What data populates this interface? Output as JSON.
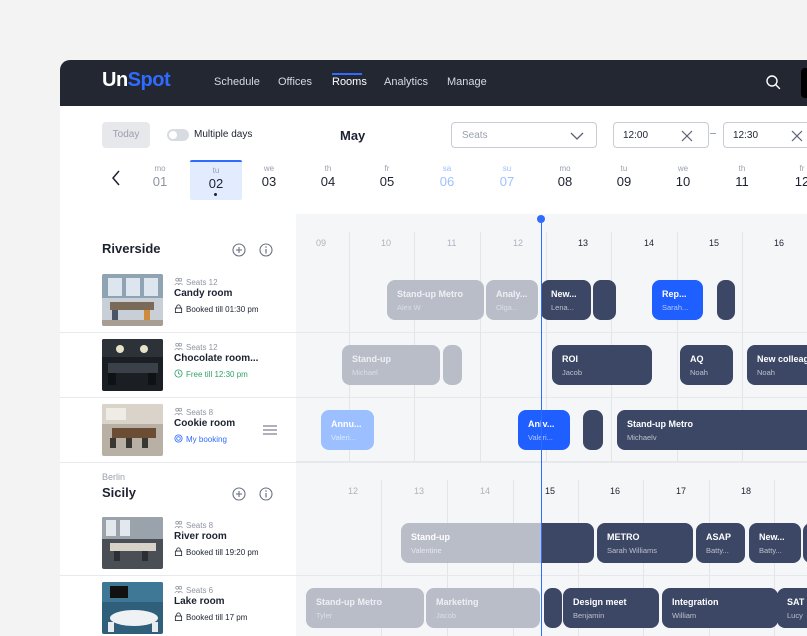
{
  "nav": {
    "logo_un": "Un",
    "logo_spot": "Spot",
    "items": [
      "Schedule",
      "Offices",
      "Rooms",
      "Analytics",
      "Manage"
    ],
    "active": "Rooms"
  },
  "toolbar": {
    "today_label": "Today",
    "multiple_days_label": "Multiple days",
    "multiple_days_enabled": false,
    "month": "May",
    "seats_placeholder": "Seats",
    "time_from": "12:00",
    "time_to": "12:30"
  },
  "dates": [
    {
      "dw": "mo",
      "dn": "01"
    },
    {
      "dw": "tu",
      "dn": "02",
      "selected": true
    },
    {
      "dw": "we",
      "dn": "03"
    },
    {
      "dw": "th",
      "dn": "04"
    },
    {
      "dw": "fr",
      "dn": "05"
    },
    {
      "dw": "sa",
      "dn": "06",
      "weekend": true
    },
    {
      "dw": "su",
      "dn": "07",
      "weekend": true
    },
    {
      "dw": "mo",
      "dn": "08"
    },
    {
      "dw": "tu",
      "dn": "09"
    },
    {
      "dw": "we",
      "dn": "10"
    },
    {
      "dw": "th",
      "dn": "11"
    },
    {
      "dw": "fr",
      "dn": "12"
    }
  ],
  "groups": [
    {
      "city": "",
      "title": "Riverside",
      "hours": [
        "09",
        "10",
        "11",
        "12",
        "13",
        "14",
        "15",
        "16"
      ],
      "rooms": [
        {
          "seats": "Seats 12",
          "name": "Candy room",
          "status": "Booked till 01:30 pm",
          "status_type": "booked",
          "bookings": [
            {
              "title": "Stand-up Metro",
              "sub": "Alex W",
              "state": "past"
            },
            {
              "title": "Analy...",
              "sub": "Olga...",
              "state": "past"
            },
            {
              "title": "New...",
              "sub": "Lena...",
              "state": "now"
            },
            {
              "title": "",
              "sub": "",
              "state": "now"
            },
            {
              "title": "Rep...",
              "sub": "Sarah...",
              "state": "mine"
            },
            {
              "title": "",
              "sub": "",
              "state": "future"
            }
          ]
        },
        {
          "seats": "Seats 12",
          "name": "Chocolate room...",
          "status": "Free till 12:30 pm",
          "status_type": "free",
          "bookings": [
            {
              "title": "Stand-up",
              "sub": "Michael",
              "state": "past"
            },
            {
              "title": "",
              "sub": "",
              "state": "past"
            },
            {
              "title": "ROI",
              "sub": "Jacob",
              "state": "future"
            },
            {
              "title": "AQ",
              "sub": "Noah",
              "state": "future"
            },
            {
              "title": "New colleag",
              "sub": "Noah",
              "state": "future"
            }
          ]
        },
        {
          "seats": "Seats 8",
          "name": "Cookie room",
          "status": "My booking",
          "status_type": "mine",
          "bookings": [
            {
              "title": "Annu...",
              "sub": "Valeri...",
              "state": "mine-past"
            },
            {
              "title": "Aniv...",
              "sub": "Valeri...",
              "state": "mine"
            },
            {
              "title": "",
              "sub": "",
              "state": "future"
            },
            {
              "title": "Stand-up Metro",
              "sub": "Michaelv",
              "state": "future"
            }
          ]
        }
      ]
    },
    {
      "city": "Berlin",
      "title": "Sicily",
      "hours": [
        "12",
        "13",
        "14",
        "15",
        "16",
        "17",
        "18"
      ],
      "rooms": [
        {
          "seats": "Seats 8",
          "name": "River room",
          "status": "Booked till 19:20 pm",
          "status_type": "booked",
          "bookings": [
            {
              "title": "Stand-up",
              "sub": "Valentine",
              "state": "now"
            },
            {
              "title": "METRO",
              "sub": "Sarah Williams",
              "state": "future"
            },
            {
              "title": "ASAP",
              "sub": "Batty...",
              "state": "future"
            },
            {
              "title": "New...",
              "sub": "Batty...",
              "state": "future"
            },
            {
              "title": "",
              "sub": "",
              "state": "future"
            }
          ]
        },
        {
          "seats": "Seats 6",
          "name": "Lake room",
          "status": "Booked till 17 pm",
          "status_type": "booked",
          "bookings": [
            {
              "title": "Stand-up Metro",
              "sub": "Tyler",
              "state": "past"
            },
            {
              "title": "Marketing",
              "sub": "Jacob",
              "state": "past"
            },
            {
              "title": "",
              "sub": "",
              "state": "future"
            },
            {
              "title": "Design meet",
              "sub": "Benjamin",
              "state": "future"
            },
            {
              "title": "Integration",
              "sub": "William",
              "state": "future"
            },
            {
              "title": "SAT",
              "sub": "Lucy",
              "state": "future"
            }
          ]
        }
      ]
    }
  ],
  "colors": {
    "accent": "#2f6bff",
    "topbar": "#232732",
    "booking": "#3b4765",
    "booking_past": "#b9bdc8",
    "free": "#2fa36b"
  },
  "icons": [
    "search-icon",
    "chevron-down-icon",
    "close-icon",
    "chevron-left-icon",
    "add-icon",
    "info-icon",
    "people-icon",
    "lock-icon",
    "clock-icon",
    "target-icon",
    "menu-icon"
  ]
}
